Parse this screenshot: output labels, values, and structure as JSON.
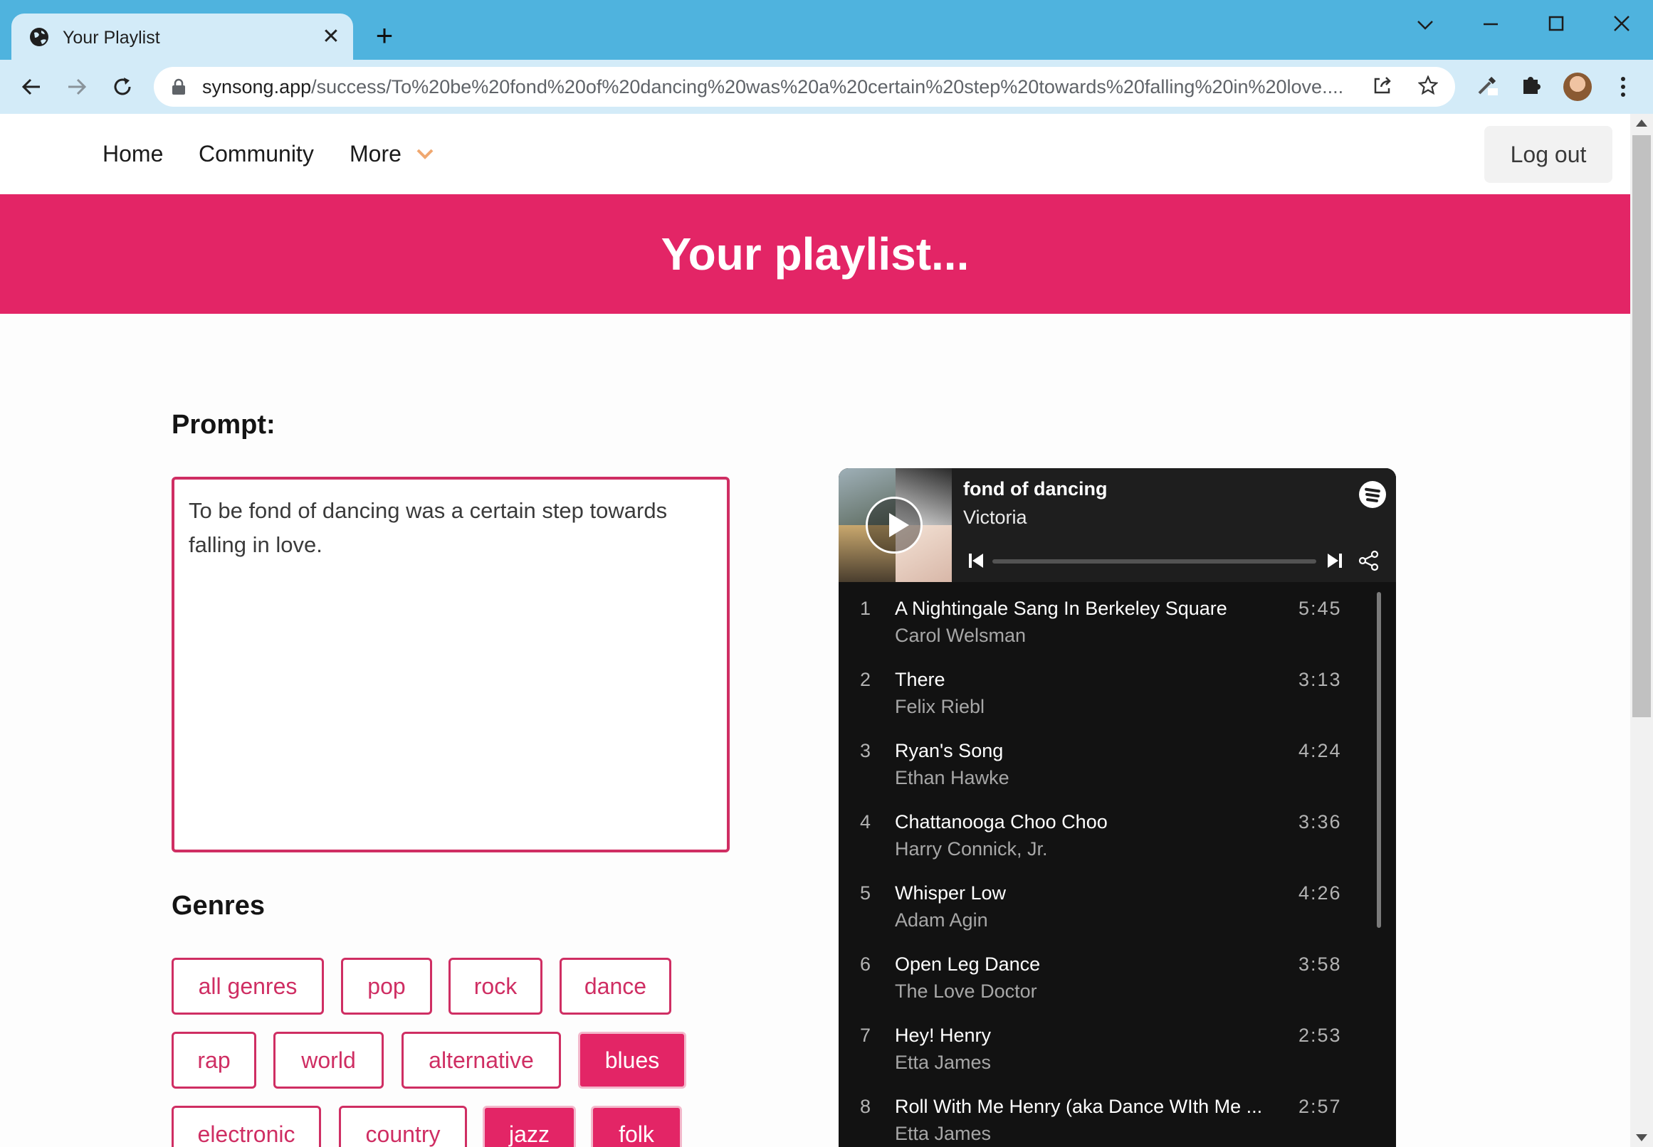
{
  "browser": {
    "tab_title": "Your Playlist",
    "url_host": "synsong.app",
    "url_path": "/success/To%20be%20fond%20of%20dancing%20was%20a%20certain%20step%20towards%20falling%20in%20love...."
  },
  "nav": {
    "home": "Home",
    "community": "Community",
    "more": "More",
    "logout": "Log out"
  },
  "banner": {
    "title": "Your playlist..."
  },
  "prompt": {
    "heading": "Prompt:",
    "text": "To be fond of dancing was a certain step towards falling in love."
  },
  "genres": {
    "heading": "Genres",
    "items": [
      {
        "label": "all genres",
        "active": false
      },
      {
        "label": "pop",
        "active": false
      },
      {
        "label": "rock",
        "active": false
      },
      {
        "label": "dance",
        "active": false
      },
      {
        "label": "rap",
        "active": false
      },
      {
        "label": "world",
        "active": false
      },
      {
        "label": "alternative",
        "active": false
      },
      {
        "label": "blues",
        "active": true
      },
      {
        "label": "electronic",
        "active": false
      },
      {
        "label": "country",
        "active": false
      },
      {
        "label": "jazz",
        "active": true
      },
      {
        "label": "folk",
        "active": true
      }
    ]
  },
  "player": {
    "playlist_title": "fond of dancing",
    "owner": "Victoria",
    "tracks": [
      {
        "num": "1",
        "title": "A Nightingale Sang In Berkeley Square",
        "artist": "Carol Welsman",
        "duration": "5:45"
      },
      {
        "num": "2",
        "title": "There",
        "artist": "Felix Riebl",
        "duration": "3:13"
      },
      {
        "num": "3",
        "title": "Ryan's Song",
        "artist": "Ethan Hawke",
        "duration": "4:24"
      },
      {
        "num": "4",
        "title": "Chattanooga Choo Choo",
        "artist": "Harry Connick, Jr.",
        "duration": "3:36"
      },
      {
        "num": "5",
        "title": "Whisper Low",
        "artist": "Adam Agin",
        "duration": "4:26"
      },
      {
        "num": "6",
        "title": "Open Leg Dance",
        "artist": "The Love Doctor",
        "duration": "3:58"
      },
      {
        "num": "7",
        "title": "Hey! Henry",
        "artist": "Etta James",
        "duration": "2:53"
      },
      {
        "num": "8",
        "title": "Roll With Me Henry (aka Dance WIth Me ...",
        "artist": "Etta James",
        "duration": "2:57"
      }
    ]
  },
  "colors": {
    "brand": "#e32566",
    "brand_border": "#cf2e63",
    "chrome_tabbar": "#4fb3de",
    "chrome_toolbar": "#d3ebf8",
    "player_bg": "#121212"
  },
  "icons": {
    "tab": "globe-icon",
    "tab_close": "close-icon",
    "new_tab": "plus-icon",
    "back": "arrow-left-icon",
    "forward": "arrow-right-icon",
    "reload": "reload-icon",
    "lock": "lock-icon",
    "share": "share-icon",
    "bookmark": "star-icon",
    "eyedropper": "eyedropper-icon",
    "extensions": "puzzle-icon",
    "menu": "kebab-menu-icon",
    "more_chevron": "chevron-down-icon",
    "play": "play-icon",
    "spotify": "spotify-logo-icon"
  }
}
